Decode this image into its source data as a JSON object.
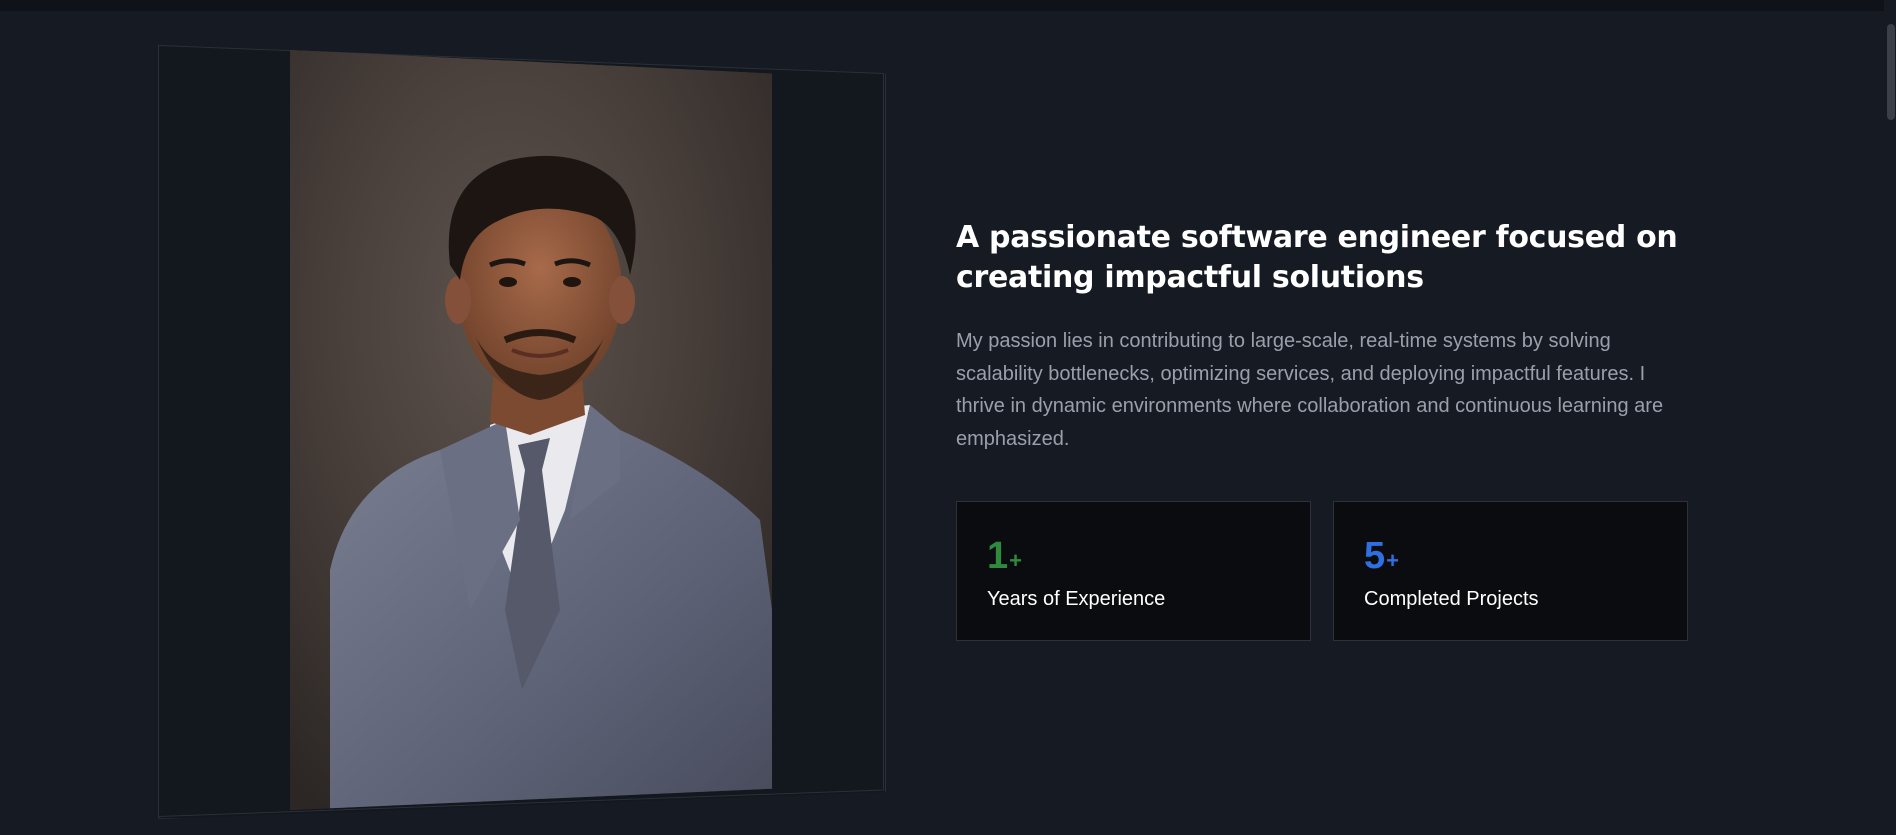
{
  "about": {
    "headline": "A passionate software engineer focused on creating impactful solutions",
    "description": "My passion lies in contributing to large-scale, real-time systems by solving scalability bottlenecks, optimizing services, and deploying impactful features. I thrive in dynamic environments where collaboration and continuous learning are emphasized.",
    "photo_icon": "portrait-photo",
    "stats": [
      {
        "value": "1",
        "suffix": "+",
        "label": "Years of Experience",
        "color": "#2e8b3e"
      },
      {
        "value": "5",
        "suffix": "+",
        "label": "Completed Projects",
        "color": "#2f6fe0"
      }
    ]
  },
  "colors": {
    "background": "#161a22",
    "card_background": "#0b0c0f",
    "headline": "#ffffff",
    "body_text": "#9aa0ab"
  }
}
